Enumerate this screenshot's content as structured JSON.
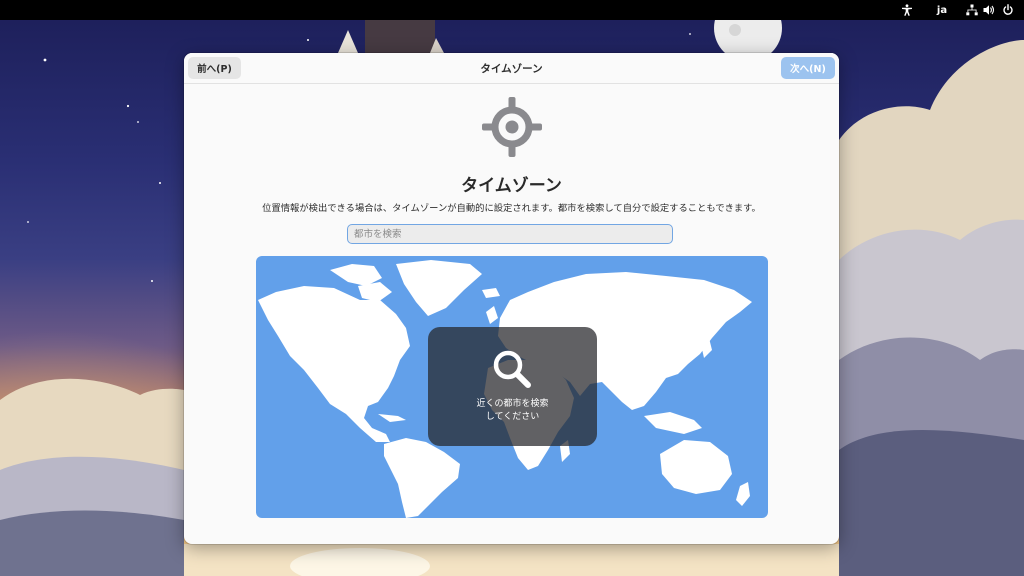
{
  "topbar": {
    "language": "ja",
    "icons": [
      "accessibility-icon",
      "network-icon",
      "volume-icon",
      "power-icon"
    ]
  },
  "dialog": {
    "header": {
      "title": "タイムゾーン",
      "prev_label": "前へ(P)",
      "next_label": "次へ(N)"
    },
    "page": {
      "icon": "location-crosshair-icon",
      "title": "タイムゾーン",
      "description": "位置情報が検出できる場合は、タイムゾーンが自動的に設定されます。都市を検索して自分で設定することもできます。"
    },
    "search": {
      "placeholder": "都市を検索",
      "value": ""
    },
    "map": {
      "overlay": {
        "icon": "search-icon",
        "line1": "近くの都市を検索",
        "line2": "してください"
      }
    }
  },
  "colors": {
    "accent": "#62a0ea",
    "next_button_disabled": "#9cc3ef",
    "dialog_bg": "#fafafa",
    "topbar_bg": "#000000"
  }
}
